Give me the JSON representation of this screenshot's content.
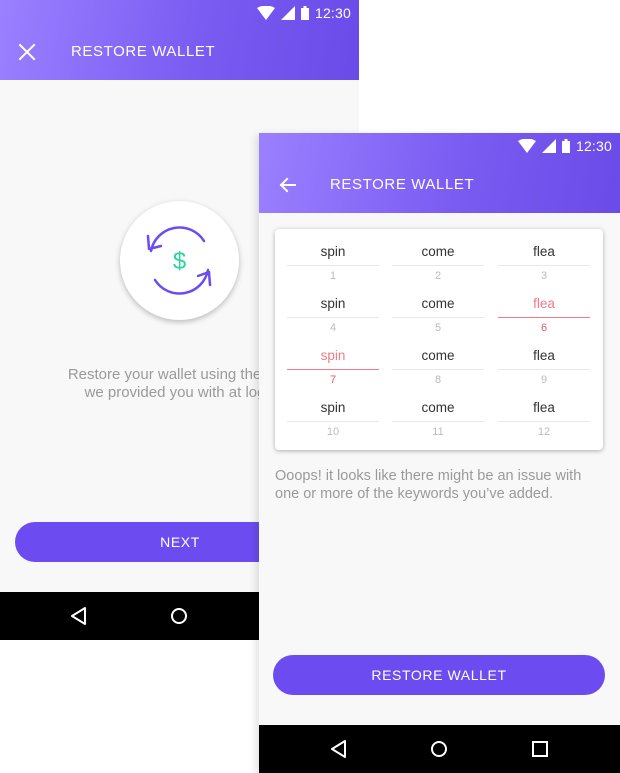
{
  "status_bar": {
    "time": "12:30"
  },
  "screen1": {
    "title": "RESTORE WALLET",
    "intro_line1": "Restore your wallet using the pa",
    "intro_line2": "we provided you with at log",
    "illustration_symbol": "$",
    "next_label": "NEXT"
  },
  "screen2": {
    "title": "RESTORE WALLET",
    "keywords": [
      {
        "word": "spin",
        "index": "1",
        "error": false
      },
      {
        "word": "come",
        "index": "2",
        "error": false
      },
      {
        "word": "flea",
        "index": "3",
        "error": false
      },
      {
        "word": "spin",
        "index": "4",
        "error": false
      },
      {
        "word": "come",
        "index": "5",
        "error": false
      },
      {
        "word": "flea",
        "index": "6",
        "error": true
      },
      {
        "word": "spin",
        "index": "7",
        "error": true
      },
      {
        "word": "come",
        "index": "8",
        "error": false
      },
      {
        "word": "flea",
        "index": "9",
        "error": false
      },
      {
        "word": "spin",
        "index": "10",
        "error": false
      },
      {
        "word": "come",
        "index": "11",
        "error": false
      },
      {
        "word": "flea",
        "index": "12",
        "error": false
      }
    ],
    "error_message": "Ooops! it looks like there might be an issue with one or more of the keywords you’ve added.",
    "restore_label": "RESTORE WALLET"
  },
  "colors": {
    "accent": "#6c4cf0",
    "error": "#f07a85",
    "money": "#2dd4a0"
  },
  "icons": {
    "screen1_nav": [
      "back-triangle-icon",
      "home-circle-icon"
    ],
    "screen2_nav": [
      "back-triangle-icon",
      "home-circle-icon",
      "recents-square-icon"
    ]
  }
}
